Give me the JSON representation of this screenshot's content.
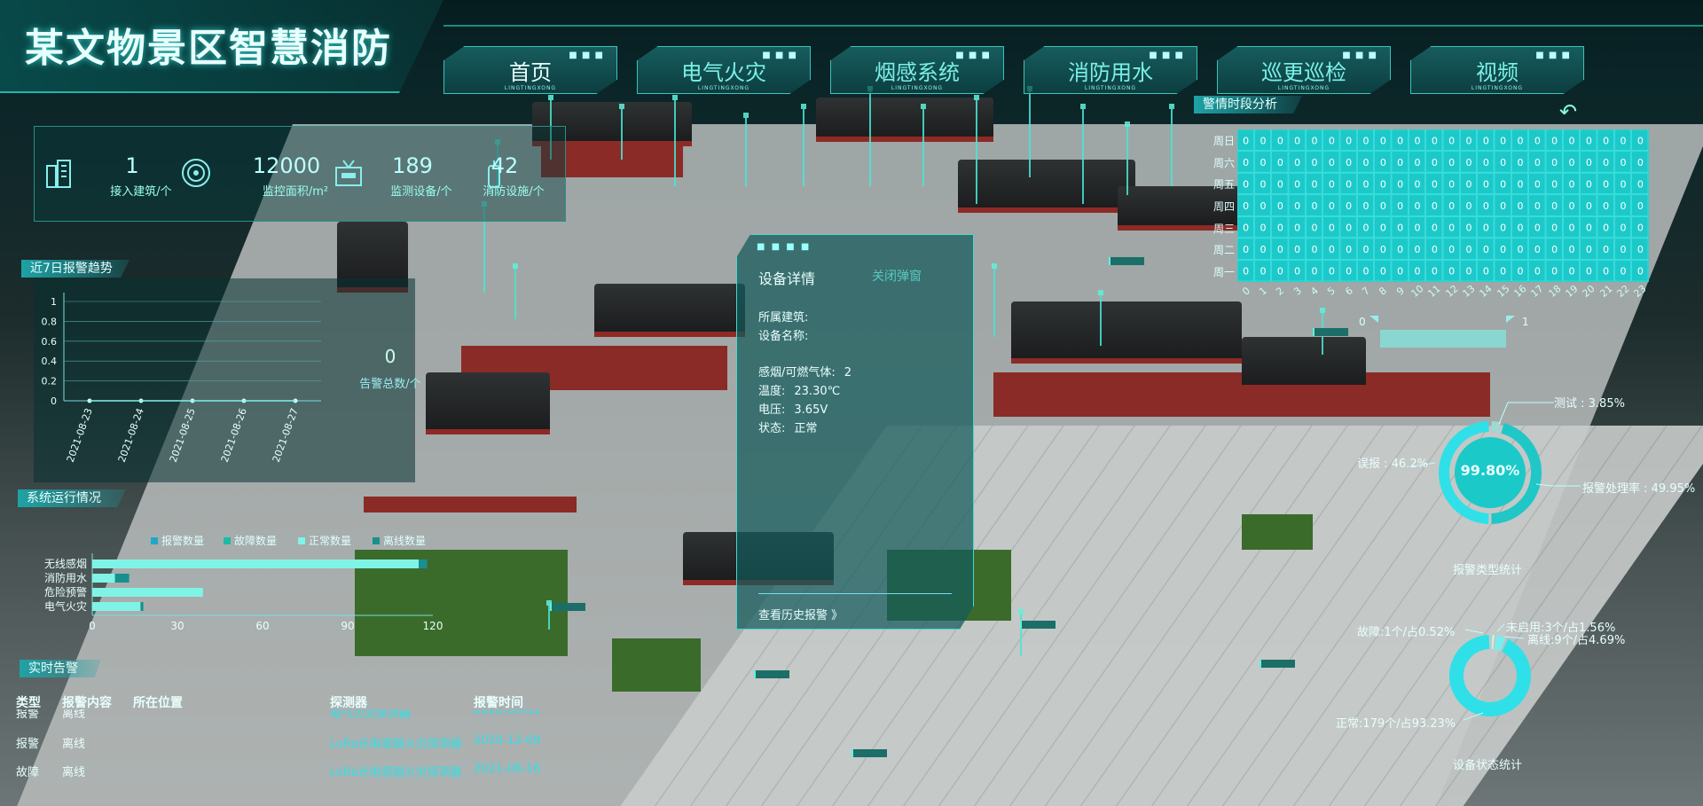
{
  "header": {
    "title": "某文物景区智慧消防",
    "tabs": [
      {
        "label": "首页",
        "sub": "LINGTINGXONG"
      },
      {
        "label": "电气火灾",
        "sub": "LINGTINGXONG"
      },
      {
        "label": "烟感系统",
        "sub": "LINGTINGXONG"
      },
      {
        "label": "消防用水",
        "sub": "LINGTINGXONG"
      },
      {
        "label": "巡更巡检",
        "sub": "LINGTINGXONG"
      },
      {
        "label": "视频",
        "sub": "LINGTINGXONG"
      }
    ],
    "tab_dots": "■ ■ ■"
  },
  "stats": [
    {
      "value": "1",
      "label": "接入建筑/个",
      "icon": "building-icon"
    },
    {
      "value": "12000",
      "label": "监控面积/m²",
      "icon": "target-icon"
    },
    {
      "value": "189",
      "label": "监测设备/个",
      "icon": "device-icon"
    },
    {
      "value": "42",
      "label": "消防设施/个",
      "icon": "extinguisher-icon"
    }
  ],
  "trend": {
    "section": "近7日报警趋势",
    "total_value": "0",
    "total_label": "告警总数/个",
    "chart_data": {
      "type": "line",
      "x": [
        "2021-08-23",
        "2021-08-24",
        "2021-08-25",
        "2021-08-26",
        "2021-08-27"
      ],
      "values": [
        0,
        0,
        0,
        0,
        0
      ],
      "y_ticks": [
        "0",
        "0.2",
        "0.4",
        "0.6",
        "0.8",
        "1"
      ],
      "ylim": [
        0,
        1
      ]
    }
  },
  "system": {
    "section": "系统运行情况",
    "legend": [
      {
        "name": "报警数量",
        "color": "#1fa7c7"
      },
      {
        "name": "故障数量",
        "color": "#1fb9a3"
      },
      {
        "name": "正常数量",
        "color": "#7ff4e6"
      },
      {
        "name": "离线数量",
        "color": "#1a8f8f"
      }
    ],
    "chart_data": {
      "type": "bar",
      "orientation": "horizontal",
      "stacked": true,
      "categories": [
        "无线感烟",
        "消防用水",
        "危险预警",
        "电气火灾"
      ],
      "series": [
        {
          "name": "报警数量",
          "values": [
            0,
            0,
            0,
            0
          ]
        },
        {
          "name": "故障数量",
          "values": [
            0,
            0,
            0,
            0
          ]
        },
        {
          "name": "正常数量",
          "values": [
            115,
            8,
            39,
            17
          ]
        },
        {
          "name": "离线数量",
          "values": [
            3,
            5,
            0,
            1
          ]
        }
      ],
      "x_ticks": [
        "0",
        "30",
        "60",
        "90",
        "120"
      ],
      "xlim": [
        0,
        120
      ]
    }
  },
  "realtime": {
    "section": "实时告警",
    "columns": [
      "类型",
      "报警内容",
      "所在位置",
      "探测器",
      "报警时间"
    ],
    "partial_row": {
      "type": "报警",
      "content": "离线",
      "detector": "电气火灾探测器",
      "time": "2020-09-01"
    },
    "rows": [
      {
        "type": "报警",
        "content": "离线",
        "location": "",
        "detector": "LoRa光电感烟火灾探测器",
        "time": "2020-12-09"
      },
      {
        "type": "故障",
        "content": "离线",
        "location": "",
        "detector": "LoRa光电感烟火灾探测器",
        "time": "2021-08-16"
      }
    ]
  },
  "popup": {
    "dots": "■ ■ ■ ■",
    "title": "设备详情",
    "close": "关闭弹窗",
    "building_label": "所属建筑:",
    "device_label": "设备名称:",
    "fields": [
      {
        "label": "感烟/可燃气体:",
        "value": "2"
      },
      {
        "label": "温度:",
        "value": "23.30℃"
      },
      {
        "label": "电压:",
        "value": "3.65V"
      },
      {
        "label": "状态:",
        "value": "正常"
      }
    ],
    "history": "查看历史报警 》"
  },
  "heatmap": {
    "section": "警情时段分析",
    "rows": [
      "周日",
      "周六",
      "周五",
      "周四",
      "周三",
      "周二",
      "周一"
    ],
    "cols": [
      "0",
      "1",
      "2",
      "3",
      "4",
      "5",
      "6",
      "7",
      "8",
      "9",
      "10",
      "11",
      "12",
      "13",
      "14",
      "15",
      "16",
      "17",
      "18",
      "19",
      "20",
      "21",
      "22",
      "23"
    ],
    "cell_value": "0",
    "range_min": "0",
    "range_max": "1"
  },
  "alarm_type": {
    "caption": "报警类型统计",
    "center": "99.80%",
    "callouts": {
      "test": "测试 : 3.85%",
      "false_alarm": "误报 : 46.2%",
      "handle_rate": "报警处理率 : 49.95%"
    },
    "chart_data": {
      "type": "pie",
      "labels": [
        "测试",
        "误报",
        "报警处理率"
      ],
      "values": [
        3.85,
        46.2,
        49.95
      ]
    }
  },
  "device_status": {
    "caption": "设备状态统计",
    "callouts": {
      "fault": "故障:1个/占0.52%",
      "unused": "未启用:3个/占1.56%",
      "offline": "离线:9个/占4.69%",
      "normal": "正常:179个/占93.23%"
    },
    "chart_data": {
      "type": "pie",
      "labels": [
        "故障",
        "未启用",
        "离线",
        "正常"
      ],
      "values": [
        0.52,
        1.56,
        4.69,
        93.23
      ]
    }
  },
  "colors": {
    "accent": "#2fe0e8",
    "panel": "#0a4a4c",
    "line": "#48e6d4"
  }
}
